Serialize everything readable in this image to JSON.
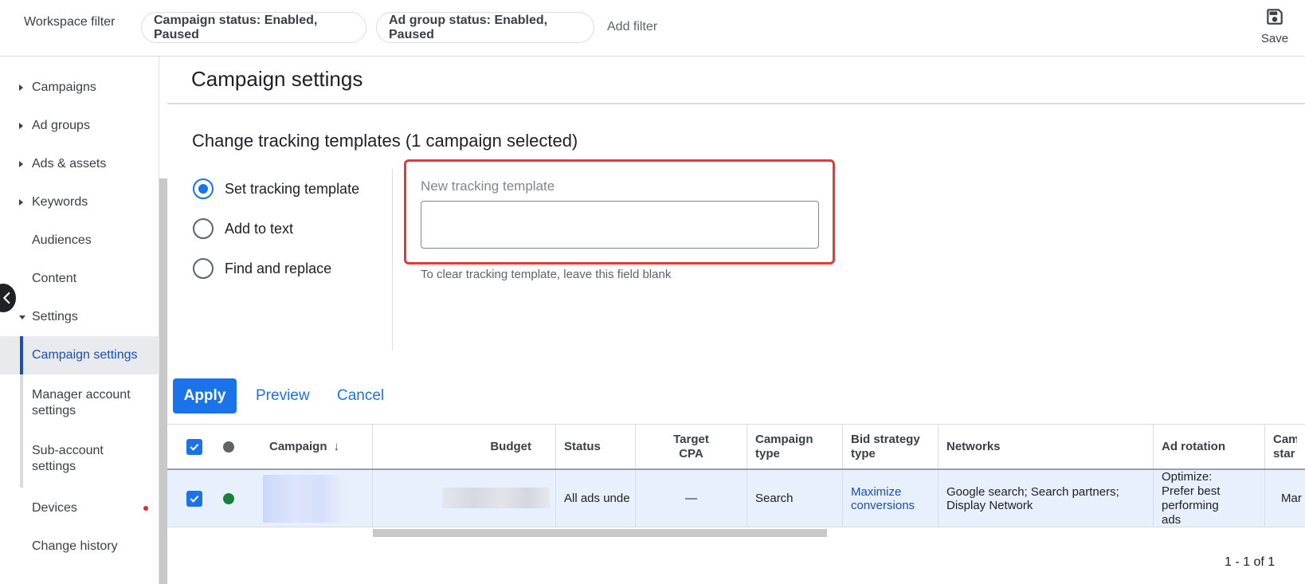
{
  "topbar": {
    "workspace_filter": "Workspace filter",
    "chips": [
      "Campaign status: Enabled, Paused",
      "Ad group status: Enabled, Paused"
    ],
    "add_filter": "Add filter",
    "save_label": "Save"
  },
  "sidebar": {
    "items": [
      {
        "label": "Campaigns"
      },
      {
        "label": "Ad groups"
      },
      {
        "label": "Ads & assets"
      },
      {
        "label": "Keywords"
      },
      {
        "label": "Audiences"
      },
      {
        "label": "Content"
      },
      {
        "label": "Settings"
      },
      {
        "label": "Campaign settings"
      },
      {
        "label": "Manager account settings"
      },
      {
        "label": "Sub-account settings"
      },
      {
        "label": "Devices"
      },
      {
        "label": "Change history"
      }
    ]
  },
  "main": {
    "page_title": "Campaign settings",
    "section_title": "Change tracking templates (1 campaign selected)",
    "options": [
      "Set tracking template",
      "Add to text",
      "Find and replace"
    ],
    "selected_option": "Set tracking template",
    "field_label": "New tracking template",
    "field_value": "",
    "helper_text": "To clear tracking template, leave this field blank",
    "apply_label": "Apply",
    "preview_label": "Preview",
    "cancel_label": "Cancel"
  },
  "table": {
    "headers": {
      "campaign": "Campaign",
      "budget": "Budget",
      "status": "Status",
      "target_cpa": "Target CPA",
      "campaign_type": "Campaign type",
      "bid_strategy_type": "Bid strategy type",
      "networks": "Networks",
      "ad_rotation": "Ad rotation",
      "campaign_start": "Cam star"
    },
    "row": {
      "status": "All ads unde",
      "target_cpa": "—",
      "campaign_type": "Search",
      "bid_strategy": "Maximize conversions",
      "networks": "Google search; Search partners; Display Network",
      "ad_rotation": "Optimize: Prefer best performing ads",
      "campaign_start": "Mar"
    },
    "pager": "1 - 1 of 1"
  },
  "colors": {
    "accent": "#1a73e8",
    "highlight_box": "#e53935",
    "enabled_dot": "#188038"
  }
}
